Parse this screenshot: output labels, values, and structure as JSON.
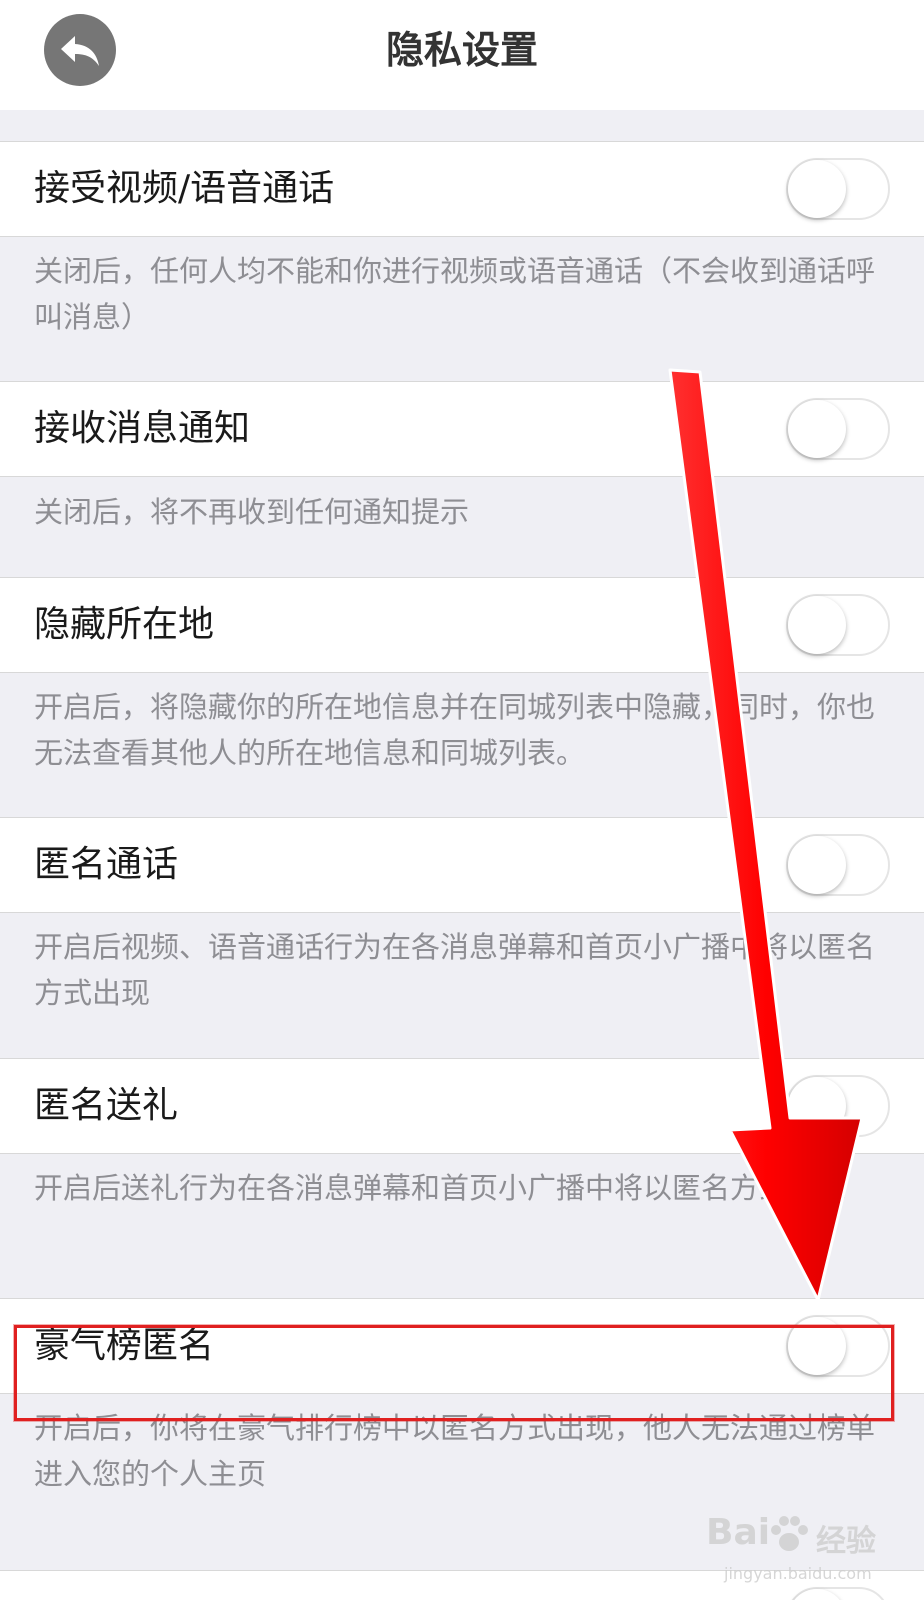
{
  "header": {
    "title": "隐私设置"
  },
  "settings": [
    {
      "label": "接受视频/语音通话",
      "enabled": false,
      "description": "关闭后，任何人均不能和你进行视频或语音通话（不会收到通话呼叫消息）"
    },
    {
      "label": "接收消息通知",
      "enabled": false,
      "description": "关闭后，将不再收到任何通知提示"
    },
    {
      "label": "隐藏所在地",
      "enabled": false,
      "description": "开启后，将隐藏你的所在地信息并在同城列表中隐藏，同时，你也无法查看其他人的所在地信息和同城列表。"
    },
    {
      "label": "匿名通话",
      "enabled": false,
      "description": "开启后视频、语音通话行为在各消息弹幕和首页小广播中将以匿名方式出现"
    },
    {
      "label": "匿名送礼",
      "enabled": false,
      "description": "开启后送礼行为在各消息弹幕和首页小广播中将以匿名方式出现"
    },
    {
      "label": "豪气榜匿名",
      "enabled": false,
      "description": "开启后，你将在豪气排行榜中以匿名方式出现，他人无法通过榜单进入您的个人主页"
    }
  ],
  "annotation": {
    "highlighted_item": "豪气榜匿名",
    "arrow_color": "#ff1a1a"
  },
  "watermark": {
    "logo": "Bai",
    "logo_suffix": "经验",
    "url": "jingyan.baidu.com"
  },
  "colors": {
    "background": "#efeff4",
    "row": "#ffffff",
    "description": "#8e8e93",
    "highlight": "#e02020"
  }
}
